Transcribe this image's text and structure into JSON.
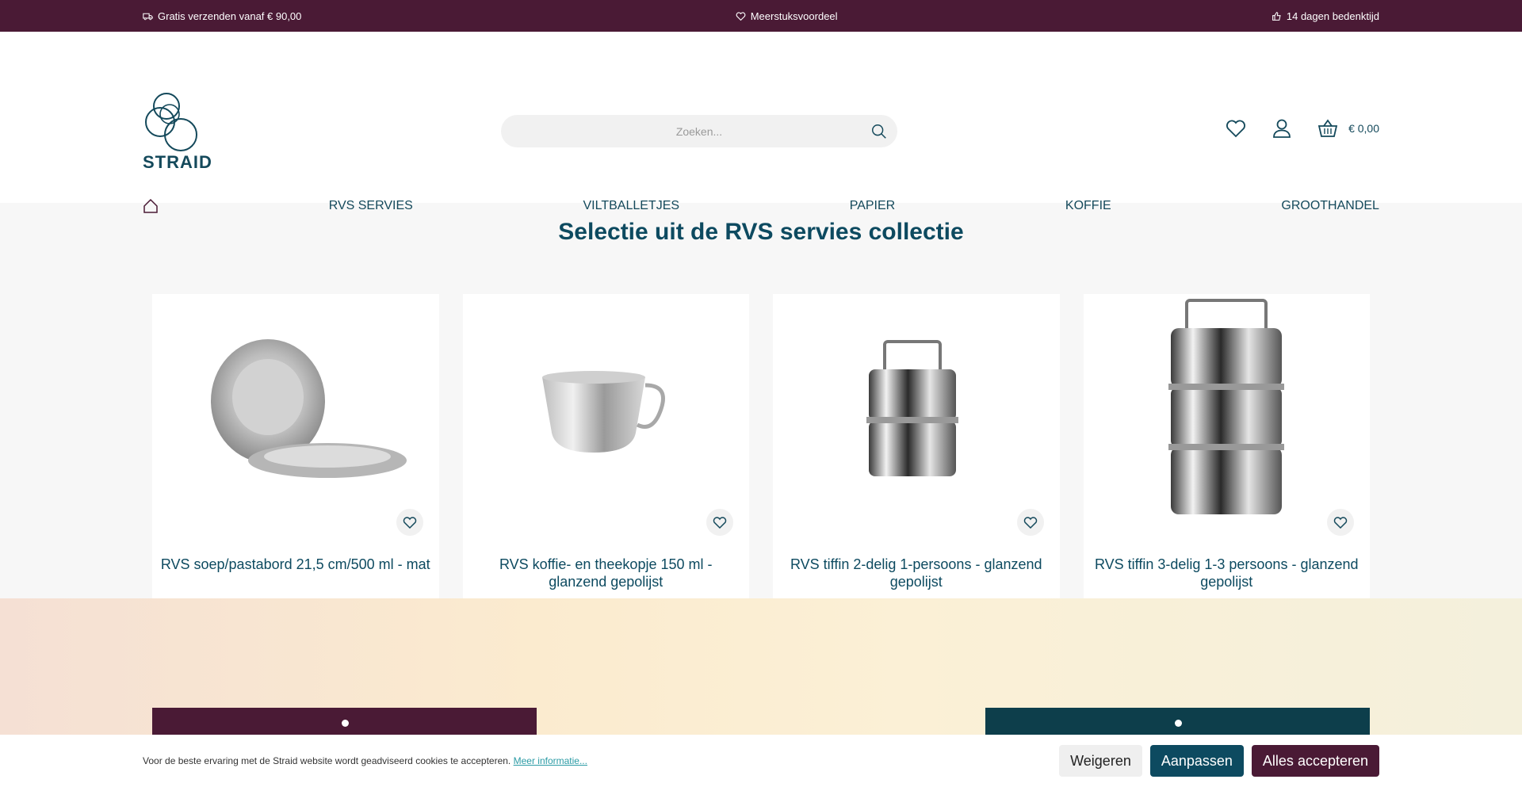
{
  "topbar": {
    "shipping": "Gratis verzenden vanaf € 90,00",
    "multi": "Meerstuksvoordeel",
    "return": "14 dagen bedenktijd"
  },
  "header": {
    "logo_text": "STRAID",
    "search_placeholder": "Zoeken...",
    "cart_total": "€ 0,00"
  },
  "nav": {
    "items": [
      "RVS SERVIES",
      "VILTBALLETJES",
      "PAPIER",
      "KOFFIE",
      "GROOTHANDEL"
    ]
  },
  "section": {
    "title": "Selectie uit de RVS servies collectie"
  },
  "products": [
    {
      "title": "RVS soep/pastabord 21,5 cm/500 ml - mat",
      "icon": "plate"
    },
    {
      "title": "RVS koffie- en theekopje 150 ml - glanzend gepolijst",
      "icon": "cup"
    },
    {
      "title": "RVS tiffin 2-delig 1-persoons - glanzend gepolijst",
      "icon": "tiffin-2"
    },
    {
      "title": "RVS tiffin 3-delig 1-3 persoons - glanzend gepolijst",
      "icon": "tiffin-3"
    }
  ],
  "cookie": {
    "text": "Voor de beste ervaring met de Straid website wordt geadviseerd cookies te accepteren.",
    "link": "Meer informatie...",
    "reject": "Weigeren",
    "adjust": "Aanpassen",
    "accept": "Alles accepteren"
  },
  "colors": {
    "brand_dark": "#4a1a35",
    "brand_teal": "#0d4a60"
  }
}
